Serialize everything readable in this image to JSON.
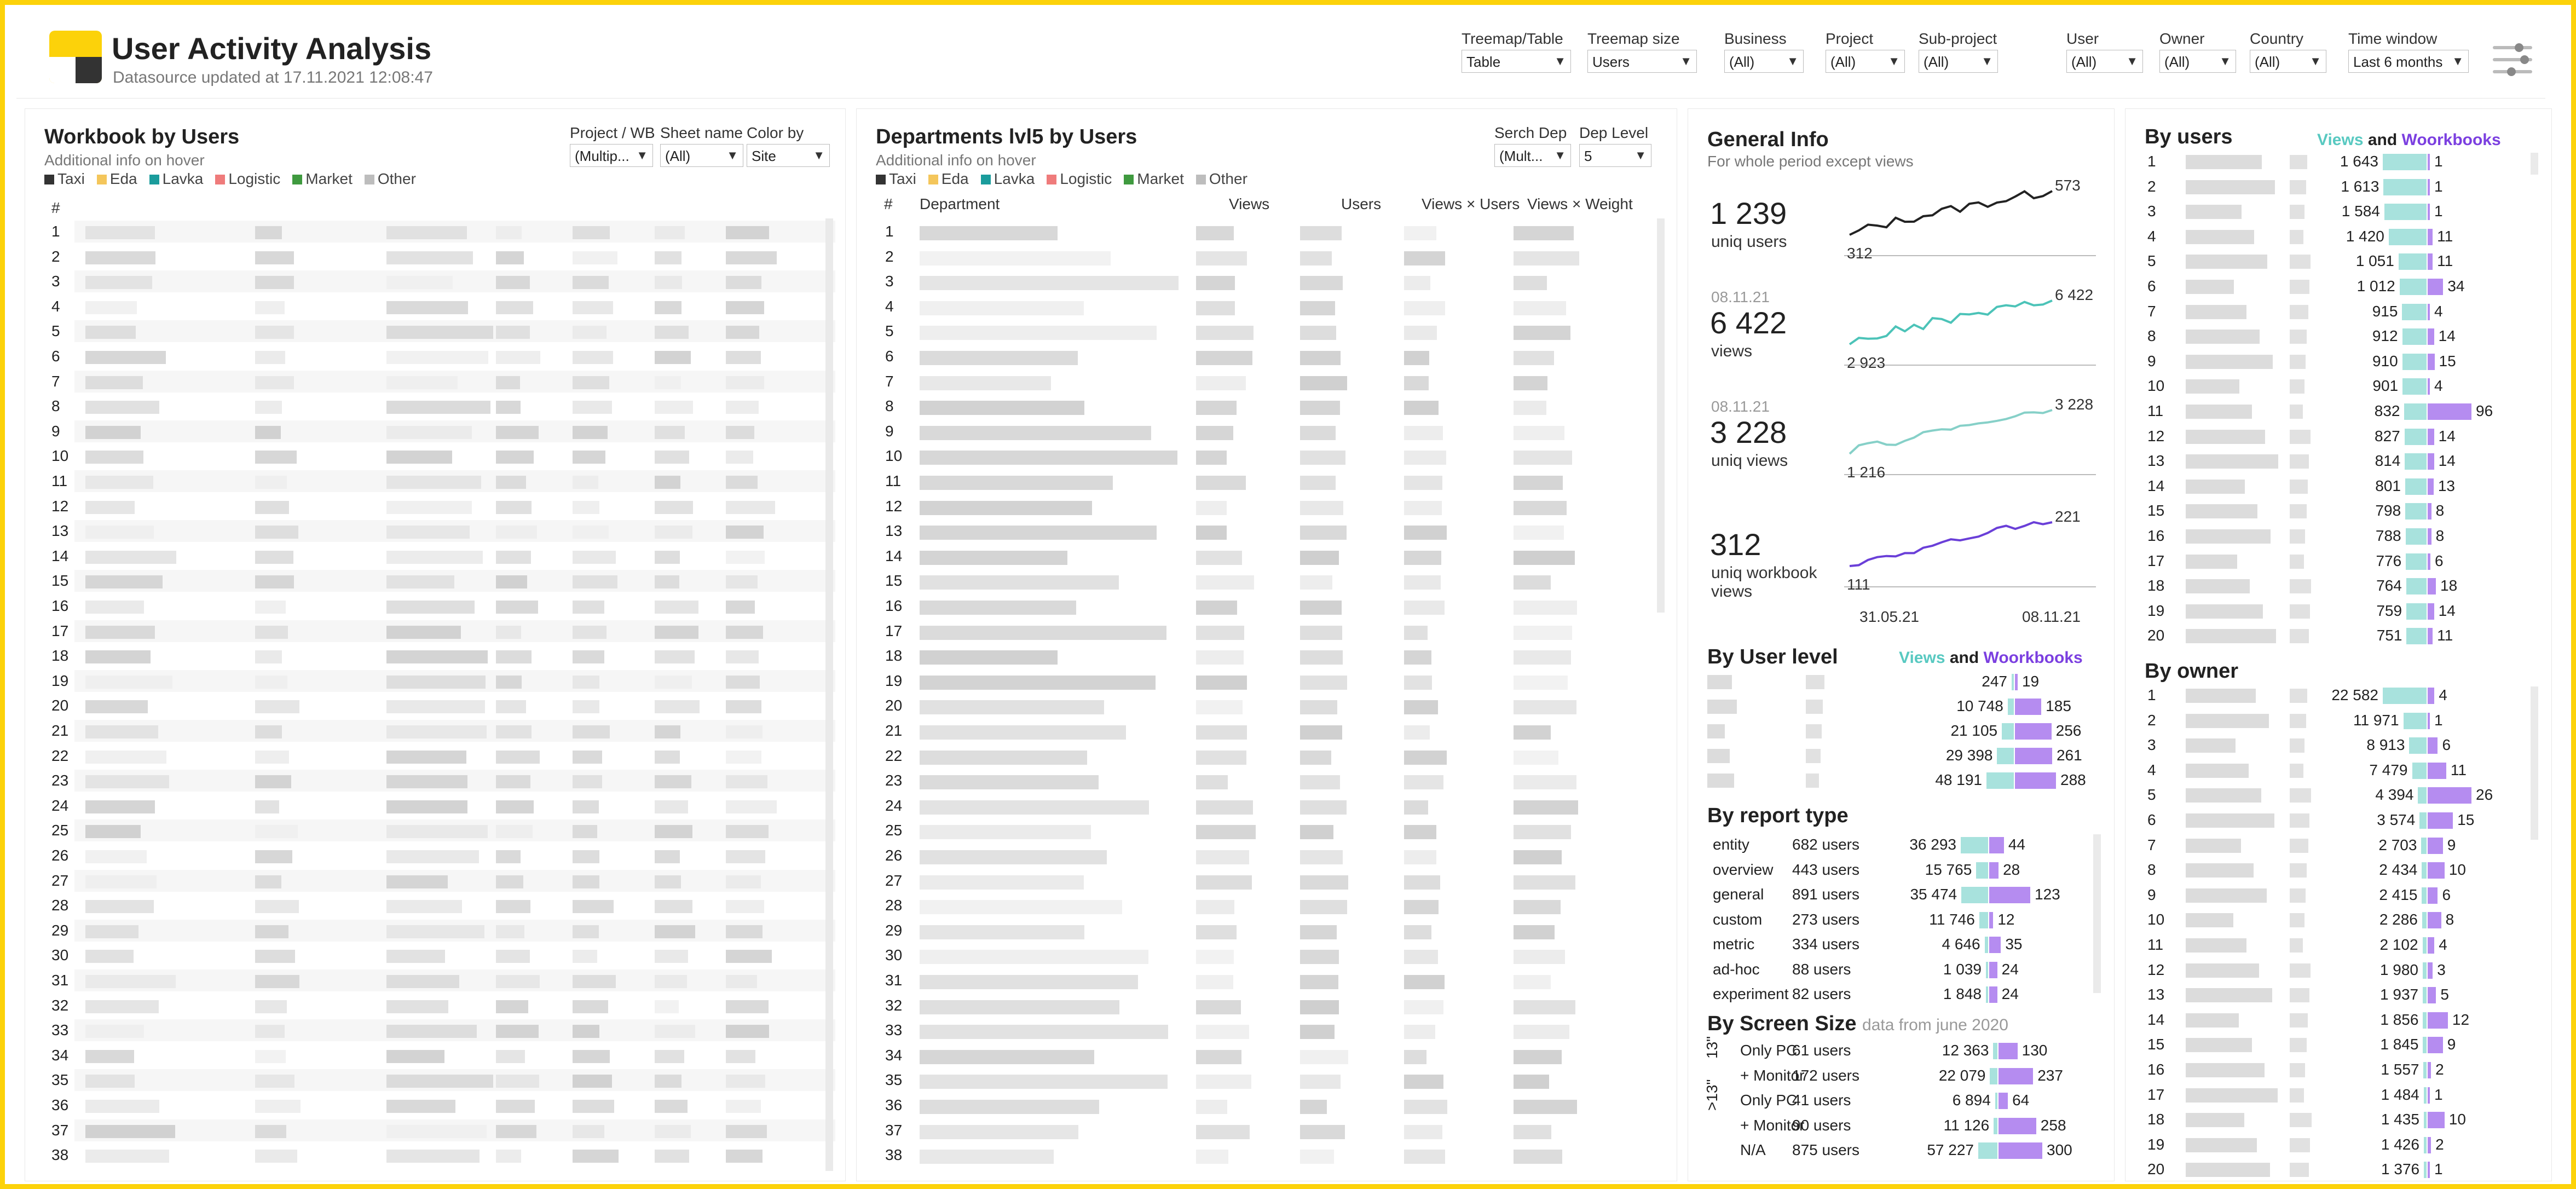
{
  "header": {
    "title": "User Activity Analysis",
    "subtitle": "Datasource updated at 17.11.2021 12:08:47",
    "filters": [
      {
        "label": "Treemap/Table",
        "value": "Table"
      },
      {
        "label": "Treemap size",
        "value": "Users"
      },
      {
        "label": "Business",
        "value": "(All)"
      },
      {
        "label": "Project",
        "value": "(All)"
      },
      {
        "label": "Sub-project",
        "value": "(All)"
      },
      {
        "label": "User",
        "value": "(All)"
      },
      {
        "label": "Owner",
        "value": "(All)"
      },
      {
        "label": "Country",
        "value": "(All)"
      },
      {
        "label": "Time window",
        "value": "Last 6 months"
      }
    ]
  },
  "legend": {
    "items": [
      {
        "label": "Taxi",
        "color": "#333333"
      },
      {
        "label": "Eda",
        "color": "#f4c65b"
      },
      {
        "label": "Lavka",
        "color": "#1a9c9c"
      },
      {
        "label": "Logistic",
        "color": "#ef7b7b"
      },
      {
        "label": "Market",
        "color": "#3f9a3f"
      },
      {
        "label": "Other",
        "color": "#bdbdbd"
      }
    ]
  },
  "workbook_panel": {
    "title": "Workbook by Users",
    "subtitle": "Additional info on hover",
    "controls": [
      {
        "label": "Project / WB",
        "value": "(Multip..."
      },
      {
        "label": "Sheet name",
        "value": "(All)"
      },
      {
        "label": "Color by",
        "value": "Site"
      }
    ],
    "num_header": "#"
  },
  "departments_panel": {
    "title": "Departments lvl5 by Users",
    "subtitle": "Additional info on hover",
    "controls": [
      {
        "label": "Serch Dep",
        "value": "(Mult..."
      },
      {
        "label": "Dep Level",
        "value": "5"
      }
    ],
    "columns": [
      "#",
      "Department",
      "Views",
      "Users",
      "Views × Users",
      "Views × Weight"
    ]
  },
  "general_info": {
    "title": "General Info",
    "subtitle": "For whole period except views",
    "stats": [
      {
        "date": "",
        "value": "1 239",
        "label": "uniq users",
        "spark_start": "312",
        "spark_end": "573",
        "color": "#222222"
      },
      {
        "date": "08.11.21",
        "value": "6 422",
        "label": "views",
        "spark_start": "2 923",
        "spark_end": "6 422",
        "color": "#4cc3b8"
      },
      {
        "date": "08.11.21",
        "value": "3 228",
        "label": "uniq views",
        "spark_start": "1 216",
        "spark_end": "3 228",
        "color": "#86d0c8"
      },
      {
        "date": "",
        "value": "312",
        "label": "uniq workbook views",
        "spark_start": "111",
        "spark_end": "221",
        "color": "#6a3fd8"
      }
    ],
    "date_start": "31.05.21",
    "date_end": "08.11.21"
  },
  "by_user_level": {
    "title": "By User level",
    "views_label": "Views",
    "and_label": "and",
    "wb_label": "Woorkbooks",
    "rows": [
      {
        "views": "247",
        "wb": "19"
      },
      {
        "views": "10 748",
        "wb": "185"
      },
      {
        "views": "21 105",
        "wb": "256"
      },
      {
        "views": "29 398",
        "wb": "261"
      },
      {
        "views": "48 191",
        "wb": "288"
      }
    ]
  },
  "by_report_type": {
    "title": "By report type",
    "rows": [
      {
        "type": "entity",
        "users": "682 users",
        "views": "36 293",
        "wb": "44"
      },
      {
        "type": "overview",
        "users": "443 users",
        "views": "15 765",
        "wb": "28"
      },
      {
        "type": "general",
        "users": "891 users",
        "views": "35 474",
        "wb": "123"
      },
      {
        "type": "custom",
        "users": "273 users",
        "views": "11 746",
        "wb": "12"
      },
      {
        "type": "metric",
        "users": "334 users",
        "views": "4 646",
        "wb": "35"
      },
      {
        "type": "ad-hoc",
        "users": "88 users",
        "views": "1 039",
        "wb": "24"
      },
      {
        "type": "experiment",
        "users": "82 users",
        "views": "1 848",
        "wb": "24"
      }
    ]
  },
  "by_screen_size": {
    "title": "By Screen Size",
    "note": "data from june 2020",
    "group1": "13\"",
    "group2": ">13\"",
    "rows": [
      {
        "type": "Only PC",
        "users": "61 users",
        "views": "12 363",
        "wb": "130"
      },
      {
        "type": "+ Monitor",
        "users": "172 users",
        "views": "22 079",
        "wb": "237"
      },
      {
        "type": "Only PC",
        "users": "41 users",
        "views": "6 894",
        "wb": "64"
      },
      {
        "type": "+ Monitor",
        "users": "90 users",
        "views": "11 126",
        "wb": "258"
      },
      {
        "type": "N/A",
        "users": "875 users",
        "views": "57 227",
        "wb": "300"
      }
    ]
  },
  "by_users": {
    "title": "By users",
    "views_label": "Views",
    "and_label": "and",
    "wb_label": "Woorkbooks",
    "rows": [
      {
        "n": "1",
        "views": "1 643",
        "wb": "1"
      },
      {
        "n": "2",
        "views": "1 613",
        "wb": "1"
      },
      {
        "n": "3",
        "views": "1 584",
        "wb": "1"
      },
      {
        "n": "4",
        "views": "1 420",
        "wb": "11"
      },
      {
        "n": "5",
        "views": "1 051",
        "wb": "11"
      },
      {
        "n": "6",
        "views": "1 012",
        "wb": "34"
      },
      {
        "n": "7",
        "views": "915",
        "wb": "4"
      },
      {
        "n": "8",
        "views": "912",
        "wb": "14"
      },
      {
        "n": "9",
        "views": "910",
        "wb": "15"
      },
      {
        "n": "10",
        "views": "901",
        "wb": "4"
      },
      {
        "n": "11",
        "views": "832",
        "wb": "96"
      },
      {
        "n": "12",
        "views": "827",
        "wb": "14"
      },
      {
        "n": "13",
        "views": "814",
        "wb": "14"
      },
      {
        "n": "14",
        "views": "801",
        "wb": "13"
      },
      {
        "n": "15",
        "views": "798",
        "wb": "8"
      },
      {
        "n": "16",
        "views": "788",
        "wb": "8"
      },
      {
        "n": "17",
        "views": "776",
        "wb": "6"
      },
      {
        "n": "18",
        "views": "764",
        "wb": "18"
      },
      {
        "n": "19",
        "views": "759",
        "wb": "14"
      },
      {
        "n": "20",
        "views": "751",
        "wb": "11"
      }
    ]
  },
  "by_owner": {
    "title": "By owner",
    "rows": [
      {
        "n": "1",
        "views": "22 582",
        "wb": "4"
      },
      {
        "n": "2",
        "views": "11 971",
        "wb": "1"
      },
      {
        "n": "3",
        "views": "8 913",
        "wb": "6"
      },
      {
        "n": "4",
        "views": "7 479",
        "wb": "11"
      },
      {
        "n": "5",
        "views": "4 394",
        "wb": "26"
      },
      {
        "n": "6",
        "views": "3 574",
        "wb": "15"
      },
      {
        "n": "7",
        "views": "2 703",
        "wb": "9"
      },
      {
        "n": "8",
        "views": "2 434",
        "wb": "10"
      },
      {
        "n": "9",
        "views": "2 415",
        "wb": "6"
      },
      {
        "n": "10",
        "views": "2 286",
        "wb": "8"
      },
      {
        "n": "11",
        "views": "2 102",
        "wb": "4"
      },
      {
        "n": "12",
        "views": "1 980",
        "wb": "3"
      },
      {
        "n": "13",
        "views": "1 937",
        "wb": "5"
      },
      {
        "n": "14",
        "views": "1 856",
        "wb": "12"
      },
      {
        "n": "15",
        "views": "1 845",
        "wb": "9"
      },
      {
        "n": "16",
        "views": "1 557",
        "wb": "2"
      },
      {
        "n": "17",
        "views": "1 484",
        "wb": "1"
      },
      {
        "n": "18",
        "views": "1 435",
        "wb": "10"
      },
      {
        "n": "19",
        "views": "1 426",
        "wb": "2"
      },
      {
        "n": "20",
        "views": "1 376",
        "wb": "1"
      }
    ]
  },
  "colors": {
    "views_bar": "#a8e2dd",
    "wb_bar": "#b58cf0",
    "brand": "#fcd20a"
  }
}
